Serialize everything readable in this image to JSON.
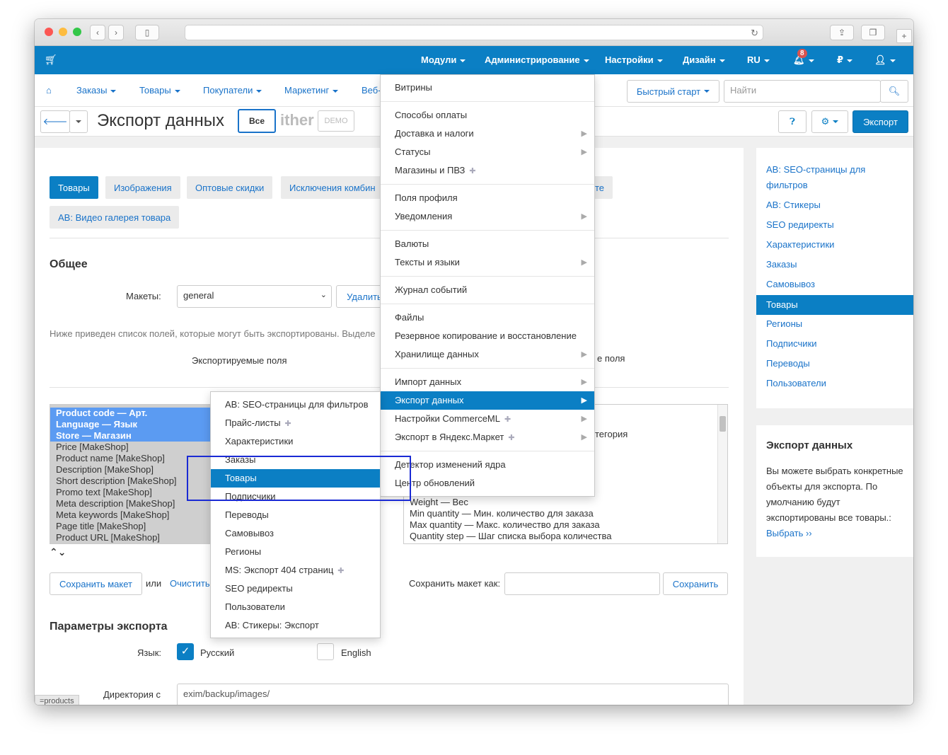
{
  "topnav": {
    "items": [
      {
        "label": "Модули"
      },
      {
        "label": "Администрирование"
      },
      {
        "label": "Настройки"
      },
      {
        "label": "Дизайн"
      },
      {
        "label": "RU"
      },
      {
        "label": "₽"
      }
    ],
    "notifications_count": "8",
    "accent_color": "#0b7fc4"
  },
  "subnav": {
    "items": [
      {
        "label": "Заказы"
      },
      {
        "label": "Товары"
      },
      {
        "label": "Покупатели"
      },
      {
        "label": "Маркетинг"
      },
      {
        "label": "Веб-"
      }
    ],
    "quick_start": "Быстрый старт",
    "search_placeholder": "Найти"
  },
  "titlebar": {
    "title": "Экспорт данных",
    "all_button": "Все",
    "logo_text": "ither",
    "demo_text": "DEMO",
    "export_button": "Экспорт"
  },
  "tabs": [
    {
      "label": "Товары",
      "active": true
    },
    {
      "label": "Изображения"
    },
    {
      "label": "Оптовые скидки"
    },
    {
      "label": "Исключения комбин"
    },
    {
      "label": "те"
    },
    {
      "label": "AB: Видео галерея товара"
    }
  ],
  "general": {
    "heading": "Общее",
    "layouts_label": "Макеты:",
    "layout_value": "general",
    "delete_button": "Удалить",
    "description": "Ниже приведен список полей, которые могут быть экспортированы. Выделе",
    "exported_fields": "Экспортируемые поля",
    "available_fields": "е поля"
  },
  "exported_list": [
    {
      "text": "Product code — Арт.",
      "selected": true
    },
    {
      "text": "Language — Язык",
      "selected": true
    },
    {
      "text": "Store — Магазин",
      "selected": true
    },
    {
      "text": "Price [MakeShop]"
    },
    {
      "text": "Product name [MakeShop]"
    },
    {
      "text": "Description [MakeShop]"
    },
    {
      "text": "Short description [MakeShop]"
    },
    {
      "text": "Promo text [MakeShop]"
    },
    {
      "text": "Meta description [MakeShop]"
    },
    {
      "text": "Meta keywords [MakeShop]"
    },
    {
      "text": "Page title [MakeShop]"
    },
    {
      "text": "Product URL [MakeShop]"
    }
  ],
  "available_list": [
    {
      "text": "тегория"
    },
    {
      "text": "Weight — Вес"
    },
    {
      "text": "Min quantity — Мин. количество для заказа"
    },
    {
      "text": "Max quantity — Макс. количество для заказа"
    },
    {
      "text": "Quantity step — Шаг списка выбора количества"
    }
  ],
  "layout_actions": {
    "save_layout": "Сохранить макет",
    "or": "или",
    "clear": "Очистить",
    "save_as_label": "Сохранить макет как:",
    "save_button": "Сохранить"
  },
  "params": {
    "heading": "Параметры экспорта",
    "language_label": "Язык:",
    "lang_ru": "Русский",
    "lang_en": "English",
    "dir_label": "Директория с",
    "dir_value": "exim/backup/images/"
  },
  "status_tab": "=products",
  "sidebar": {
    "links": [
      "AB: SEO-страницы для фильтров",
      "AB: Стикеры",
      "SEO редиректы",
      "Характеристики",
      "Заказы",
      "Самовывоз",
      "Товары",
      "Регионы",
      "Подписчики",
      "Переводы",
      "Пользователи"
    ],
    "active_index": 6,
    "info_heading": "Экспорт данных",
    "info_text": "Вы можете выбрать конкретные объекты для экспорта. По умолчанию будут экспортированы все товары.:",
    "info_link": "Выбрать ››"
  },
  "admin_menu": {
    "groups": [
      [
        {
          "label": "Витрины"
        }
      ],
      [
        {
          "label": "Способы оплаты"
        },
        {
          "label": "Доставка и налоги",
          "sub": true
        },
        {
          "label": "Статусы",
          "sub": true
        },
        {
          "label": "Магазины и ПВЗ",
          "puzzle": true
        }
      ],
      [
        {
          "label": "Поля профиля"
        },
        {
          "label": "Уведомления",
          "sub": true
        }
      ],
      [
        {
          "label": "Валюты"
        },
        {
          "label": "Тексты и языки",
          "sub": true
        }
      ],
      [
        {
          "label": "Журнал событий"
        }
      ],
      [
        {
          "label": "Файлы"
        },
        {
          "label": "Резервное копирование и восстановление"
        },
        {
          "label": "Хранилище данных",
          "sub": true
        }
      ],
      [
        {
          "label": "Импорт данных",
          "sub": true
        },
        {
          "label": "Экспорт данных",
          "sub": true,
          "active": true
        },
        {
          "label": "Настройки CommerceML",
          "sub": true,
          "puzzle": true
        },
        {
          "label": "Экспорт в Яндекс.Маркет",
          "sub": true,
          "puzzle": true
        }
      ],
      [
        {
          "label": "Детектор изменений ядра"
        },
        {
          "label": "Центр обновлений"
        }
      ]
    ]
  },
  "export_submenu": [
    {
      "label": "AB: SEO-страницы для фильтров"
    },
    {
      "label": "Прайс-листы",
      "puzzle": true
    },
    {
      "label": "Характеристики"
    },
    {
      "label": "Заказы"
    },
    {
      "label": "Товары",
      "active": true
    },
    {
      "label": "Подписчики"
    },
    {
      "label": "Переводы"
    },
    {
      "label": "Самовывоз"
    },
    {
      "label": "Регионы"
    },
    {
      "label": "MS: Экспорт 404 страниц",
      "puzzle": true
    },
    {
      "label": "SEO редиректы"
    },
    {
      "label": "Пользователи"
    },
    {
      "label": "AB: Стикеры: Экспорт"
    }
  ]
}
